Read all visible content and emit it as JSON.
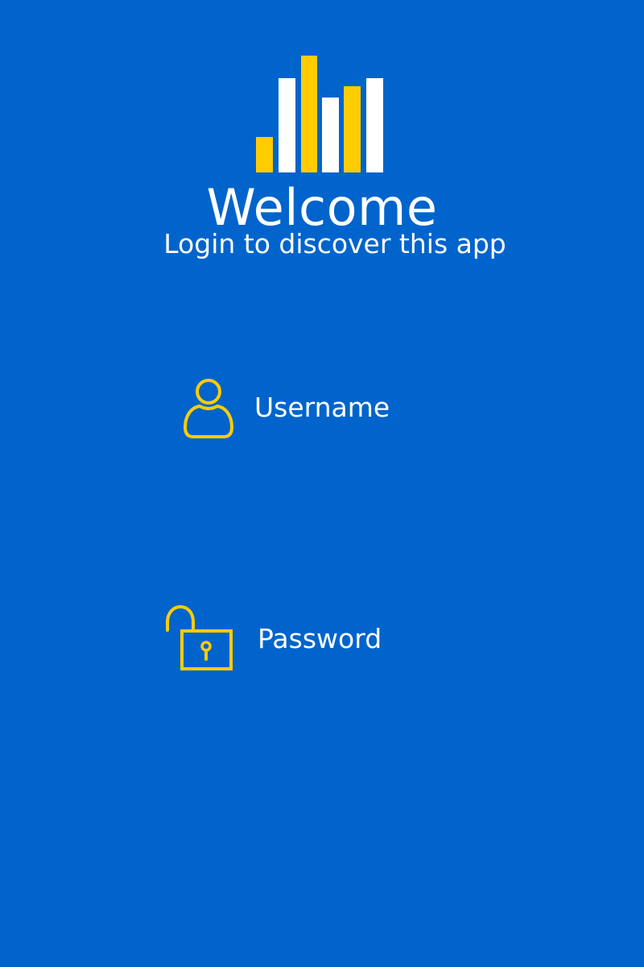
{
  "logo": {
    "icon": "bar-chart-logo-icon",
    "bar_colors": [
      "#FFCC00",
      "#FFFFFF",
      "#FFCC00",
      "#FFFFFF",
      "#FFCC00",
      "#FFFFFF"
    ]
  },
  "header": {
    "title": "Welcome",
    "subtitle": "Login to discover this app"
  },
  "form": {
    "username": {
      "icon": "user-icon",
      "placeholder": "Username"
    },
    "password": {
      "icon": "unlocked-padlock-icon",
      "placeholder": "Password"
    }
  },
  "colors": {
    "background": "#0064CC",
    "accent": "#FFCC00",
    "text": "#FFFFFF"
  }
}
